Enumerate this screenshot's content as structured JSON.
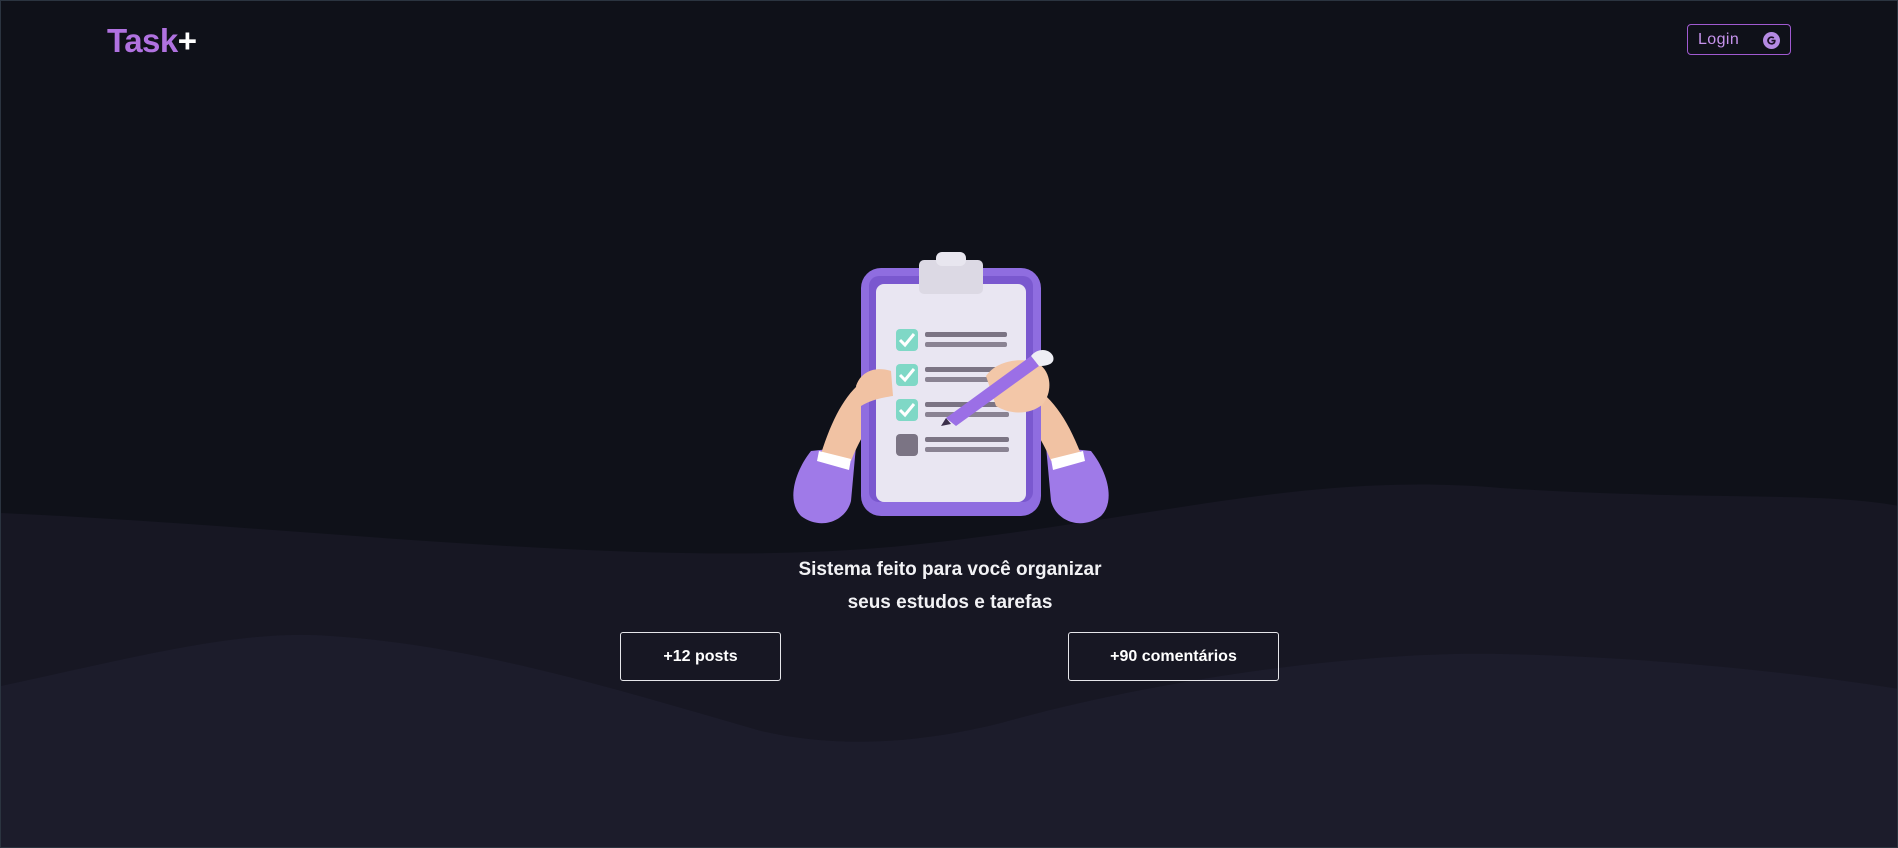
{
  "header": {
    "logo_main": "Task",
    "logo_plus": "+",
    "login_label": "Login",
    "login_icon": "google-icon"
  },
  "hero": {
    "illustration": "clipboard-checklist-illustration",
    "tagline_line1": "Sistema feito para você organizar",
    "tagline_line2": "seus estudos e tarefas"
  },
  "stats": {
    "posts": "+12 posts",
    "comments": "+90 comentários"
  },
  "colors": {
    "background": "#0f1119",
    "wave": "#1c1c2b",
    "accent": "#b072e0",
    "text": "#ffffff"
  }
}
